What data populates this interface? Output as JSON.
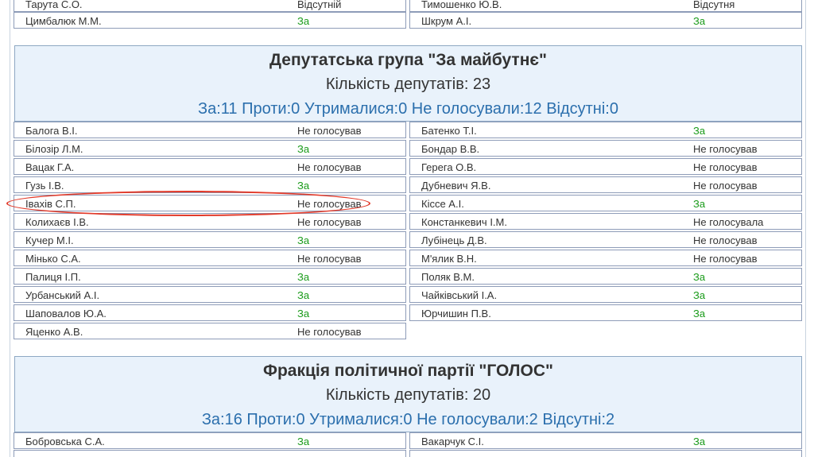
{
  "top_rows": {
    "left": [
      {
        "name": "Тарута С.О.",
        "vote": "Відсутній"
      },
      {
        "name": "Цимбалюк М.М.",
        "vote": "За"
      }
    ],
    "right": [
      {
        "name": "Тимошенко Ю.В.",
        "vote": "Відсутня"
      },
      {
        "name": "Шкрум А.І.",
        "vote": "За"
      }
    ]
  },
  "group1": {
    "title": "Депутатська група \"За майбутнє\"",
    "count": "Кількість депутатів: 23",
    "stats": "За:11 Проти:0 Утрималися:0 Не голосували:12 Відсутні:0",
    "left": [
      {
        "name": "Балога В.І.",
        "vote": "Не голосував"
      },
      {
        "name": "Білозір Л.М.",
        "vote": "За"
      },
      {
        "name": "Вацак Г.А.",
        "vote": "Не голосував"
      },
      {
        "name": "Гузь І.В.",
        "vote": "За"
      },
      {
        "name": "Івахів С.П.",
        "vote": "Не голосував"
      },
      {
        "name": "Колихаєв І.В.",
        "vote": "Не голосував"
      },
      {
        "name": "Кучер М.І.",
        "vote": "За"
      },
      {
        "name": "Мінько С.А.",
        "vote": "Не голосував"
      },
      {
        "name": "Палиця І.П.",
        "vote": "За"
      },
      {
        "name": "Урбанський А.І.",
        "vote": "За"
      },
      {
        "name": "Шаповалов Ю.А.",
        "vote": "За"
      },
      {
        "name": "Яценко А.В.",
        "vote": "Не голосував"
      }
    ],
    "right": [
      {
        "name": "Батенко Т.І.",
        "vote": "За"
      },
      {
        "name": "Бондар В.В.",
        "vote": "Не голосував"
      },
      {
        "name": "Герега О.В.",
        "vote": "Не голосував"
      },
      {
        "name": "Дубневич Я.В.",
        "vote": "Не голосував"
      },
      {
        "name": "Кіссе А.І.",
        "vote": "За"
      },
      {
        "name": "Констанкевич І.М.",
        "vote": "Не голосувала"
      },
      {
        "name": "Лубінець Д.В.",
        "vote": "Не голосував"
      },
      {
        "name": "М'ялик В.Н.",
        "vote": "Не голосував"
      },
      {
        "name": "Поляк В.М.",
        "vote": "За"
      },
      {
        "name": "Чайківський І.А.",
        "vote": "За"
      },
      {
        "name": "Юрчишин П.В.",
        "vote": "За"
      }
    ]
  },
  "group2": {
    "title": "Фракція політичної партії \"ГОЛОС\"",
    "count": "Кількість депутатів: 20",
    "stats": "За:16 Проти:0 Утрималися:0 Не голосували:2 Відсутні:2",
    "left": [
      {
        "name": "Бобровська С.А.",
        "vote": "За"
      }
    ],
    "right": [
      {
        "name": "Вакарчук С.І.",
        "vote": "За"
      }
    ]
  },
  "colors": {
    "yes": "#1a9b1a",
    "stats": "#2b6fad",
    "highlight": "#e23a2a"
  }
}
